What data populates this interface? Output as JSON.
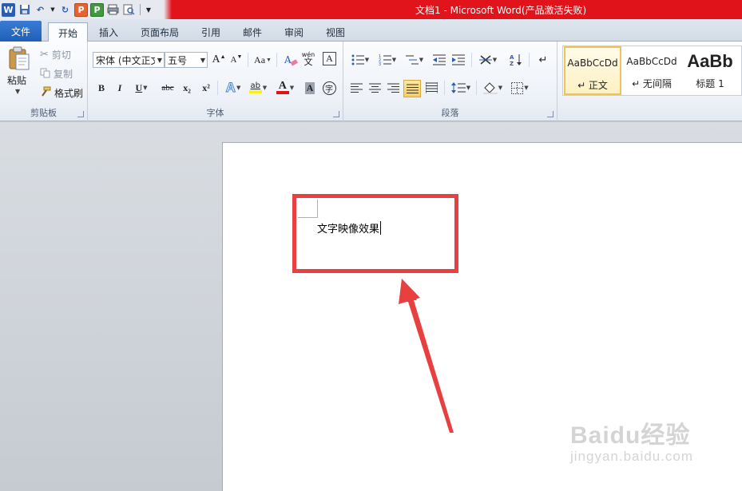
{
  "window": {
    "title": "文档1 - Microsoft Word(产品激活失败)"
  },
  "qat": {
    "items": [
      "W",
      "P",
      "P"
    ]
  },
  "tabs": [
    "文件",
    "开始",
    "插入",
    "页面布局",
    "引用",
    "邮件",
    "审阅",
    "视图"
  ],
  "clipboard": {
    "paste": "粘贴",
    "cut": "剪切",
    "copy": "复制",
    "format_painter": "格式刷",
    "label": "剪贴板"
  },
  "font": {
    "name": "宋体 (中文正文",
    "size": "五号",
    "label": "字体",
    "bold": "B",
    "italic": "I",
    "underline": "U",
    "strike": "abc",
    "sub": "x₂",
    "sup": "x²",
    "grow": "A",
    "shrink": "A",
    "case": "Aa",
    "clear": "A",
    "color_a": "A",
    "wen": "wén",
    "wen_char": "文",
    "boxed": "A",
    "highlight": "ab",
    "char_shade": "A",
    "enclose": "字"
  },
  "paragraph": {
    "label": "段落"
  },
  "styles": {
    "items": [
      {
        "sample": "AaBbCcDd",
        "name": "↵ 正文"
      },
      {
        "sample": "AaBbCcDd",
        "name": "↵ 无间隔"
      },
      {
        "sample": "AaBb",
        "name": "标题 1"
      }
    ]
  },
  "document": {
    "text": "文字映像效果"
  },
  "watermark": {
    "brand": "Baidu经验",
    "url": "jingyan.baidu.com"
  },
  "colors": {
    "accent": "#e8403f",
    "titlebar": "#e0131a",
    "file_tab": "#2b6cc4"
  }
}
